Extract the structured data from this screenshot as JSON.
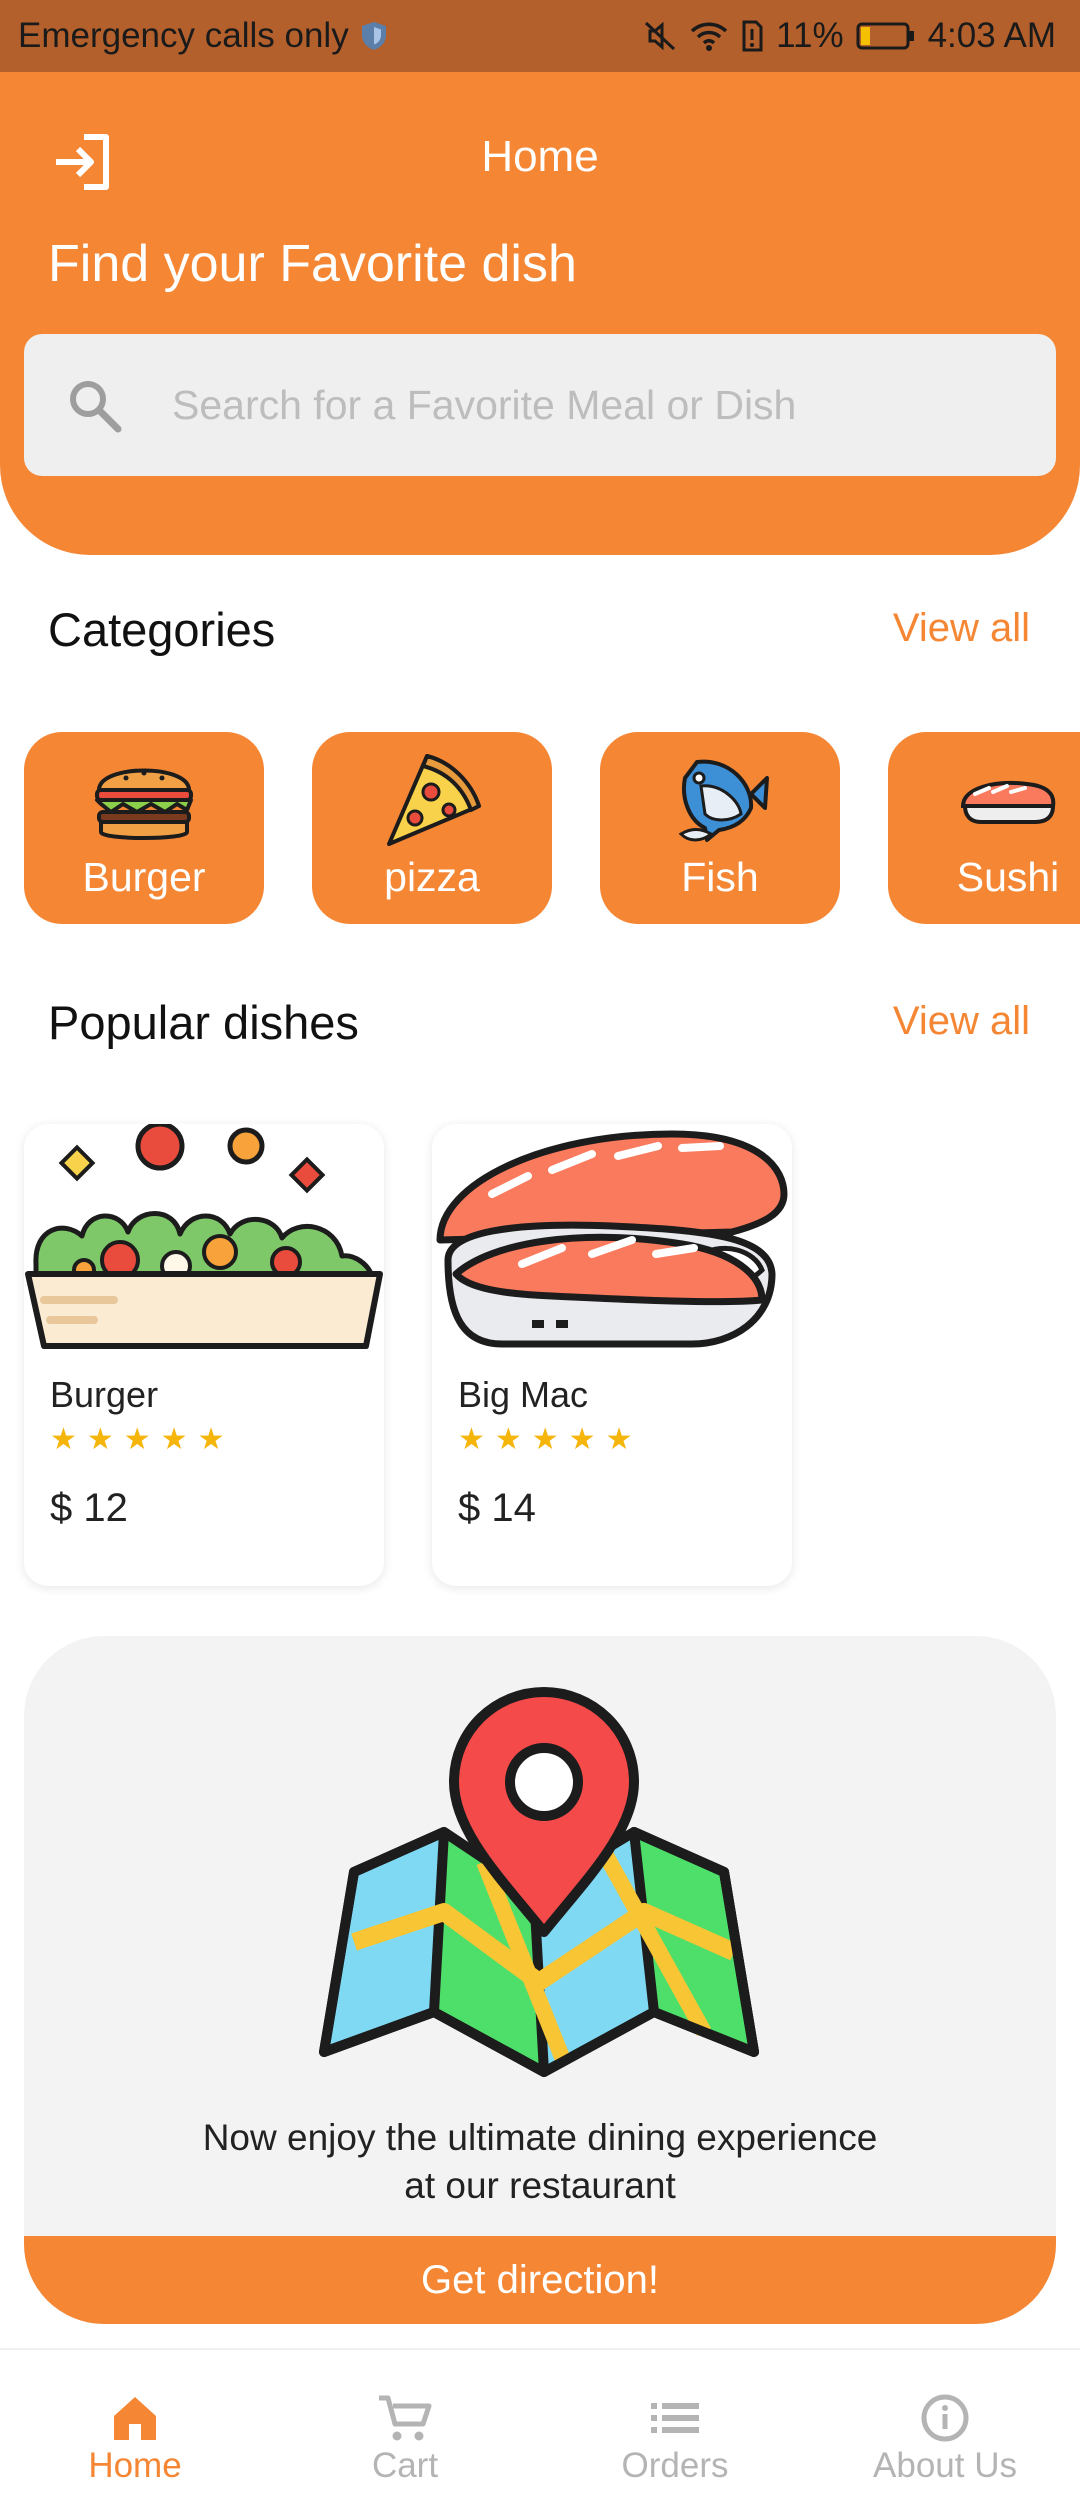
{
  "status_bar": {
    "carrier_text": "Emergency calls only",
    "battery_percent": "11%",
    "time": "4:03 AM",
    "icons": [
      "shield-icon",
      "mute-icon",
      "wifi-icon",
      "alert-sim-icon",
      "battery-icon"
    ]
  },
  "header": {
    "title": "Home",
    "heading": "Find your Favorite dish",
    "login_icon": "login-icon"
  },
  "search": {
    "placeholder": "Search for a Favorite Meal or Dish",
    "value": ""
  },
  "categories": {
    "title": "Categories",
    "view_all": "View all",
    "items": [
      {
        "label": "Burger",
        "icon": "burger-icon"
      },
      {
        "label": "pizza",
        "icon": "pizza-icon"
      },
      {
        "label": "Fish",
        "icon": "fish-icon"
      },
      {
        "label": "Sushi",
        "icon": "sushi-icon"
      }
    ]
  },
  "popular": {
    "title": "Popular dishes",
    "view_all": "View all",
    "items": [
      {
        "name": "Burger",
        "stars": "★★★★★",
        "rating": 5,
        "price": "$ 12",
        "image": "salad-image"
      },
      {
        "name": "Big Mac",
        "stars": "★★★★★",
        "rating": 5,
        "price": "$ 14",
        "image": "sushi-image"
      }
    ]
  },
  "location": {
    "text_line1": "Now enjoy the ultimate dining experience",
    "text_line2": "at our restaurant",
    "button": "Get direction!",
    "image": "map-pin-illustration"
  },
  "bottom_nav": {
    "items": [
      {
        "label": "Home",
        "icon": "home-icon",
        "active": true
      },
      {
        "label": "Cart",
        "icon": "cart-icon",
        "active": false
      },
      {
        "label": "Orders",
        "icon": "orders-icon",
        "active": false
      },
      {
        "label": "About Us",
        "icon": "info-icon",
        "active": false
      }
    ]
  },
  "colors": {
    "accent": "#f58634",
    "status_bar": "#b3602c",
    "star": "#f5b50a",
    "inactive": "#b4b4b4",
    "card_bg": "#f3f3f3"
  }
}
